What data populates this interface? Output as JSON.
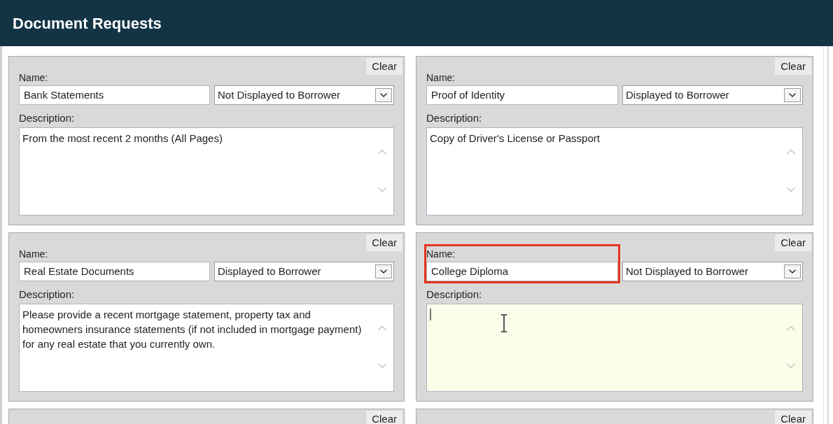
{
  "header": {
    "title": "Document Requests"
  },
  "requests": [
    {
      "clear": "Clear",
      "name_label": "Name:",
      "name": "Bank Statements",
      "visibility": "Not Displayed to Borrower",
      "description_label": "Description:",
      "description": "From the most recent 2 months (All Pages)",
      "focused": false,
      "highlighted": false
    },
    {
      "clear": "Clear",
      "name_label": "Name:",
      "name": "Proof of Identity",
      "visibility": "Displayed to Borrower",
      "description_label": "Description:",
      "description": "Copy of Driver's License or Passport",
      "focused": false,
      "highlighted": false
    },
    {
      "clear": "Clear",
      "name_label": "Name:",
      "name": "Real Estate Documents",
      "visibility": "Displayed to Borrower",
      "description_label": "Description:",
      "description": "Please provide a recent mortgage statement, property tax and homeowners insurance statements (if not included in mortgage payment) for any real estate that you currently own.",
      "focused": false,
      "highlighted": false
    },
    {
      "clear": "Clear",
      "name_label": "Name:",
      "name": "College Diploma",
      "visibility": "Not Displayed to Borrower",
      "description_label": "Description:",
      "focused": true,
      "highlighted": true
    }
  ],
  "partial_requests": [
    {
      "clear": "Clear"
    },
    {
      "clear": "Clear"
    }
  ]
}
